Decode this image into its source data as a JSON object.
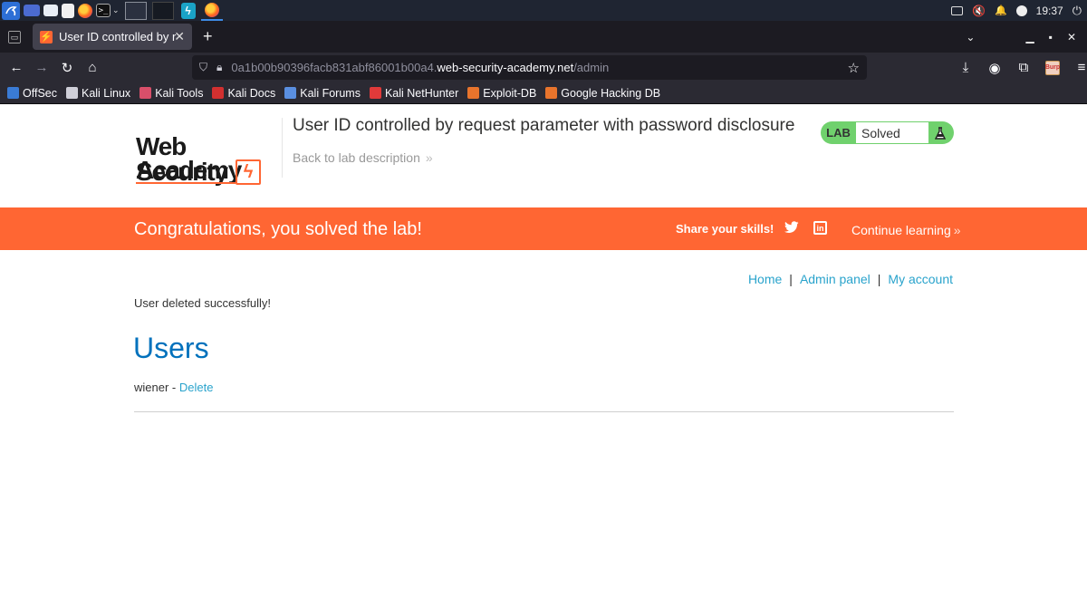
{
  "taskbar": {
    "clock": "19:37"
  },
  "browser": {
    "tab_title": "User ID controlled by request parameter with password disclosure",
    "tab_favicon": "⚡",
    "url_prefix": "0a1b00b90396facb831abf86001b00a4.",
    "url_domain": "web-security-academy.net",
    "url_path": "/admin",
    "bookmarks": [
      {
        "label": "OffSec",
        "color": "#3a7bd5"
      },
      {
        "label": "Kali Linux",
        "color": "#cfcfd8"
      },
      {
        "label": "Kali Tools",
        "color": "#d94f6a"
      },
      {
        "label": "Kali Docs",
        "color": "#d23030"
      },
      {
        "label": "Kali Forums",
        "color": "#5a8fe0"
      },
      {
        "label": "Kali NetHunter",
        "color": "#e03a3a"
      },
      {
        "label": "Exploit-DB",
        "color": "#e8742c"
      },
      {
        "label": "Google Hacking DB",
        "color": "#e8742c"
      }
    ]
  },
  "header": {
    "logo_line1": "Web Security",
    "logo_line2": "Academy",
    "lab_title": "User ID controlled by request parameter with password disclosure",
    "back_link": "Back to lab description",
    "lab_label": "LAB",
    "lab_status": "Solved"
  },
  "banner": {
    "message": "Congratulations, you solved the lab!",
    "share": "Share your skills!",
    "continue": "Continue learning"
  },
  "nav": {
    "home": "Home",
    "admin": "Admin panel",
    "account": "My account",
    "separator": "|"
  },
  "content": {
    "notice": "User deleted successfully!",
    "heading": "Users",
    "users": [
      {
        "name": "wiener",
        "separator": "-",
        "action": "Delete"
      }
    ]
  },
  "colors": {
    "accent": "#ff6633",
    "link": "#29a3cc",
    "heading": "#0071bc",
    "solved": "#70d16d"
  }
}
